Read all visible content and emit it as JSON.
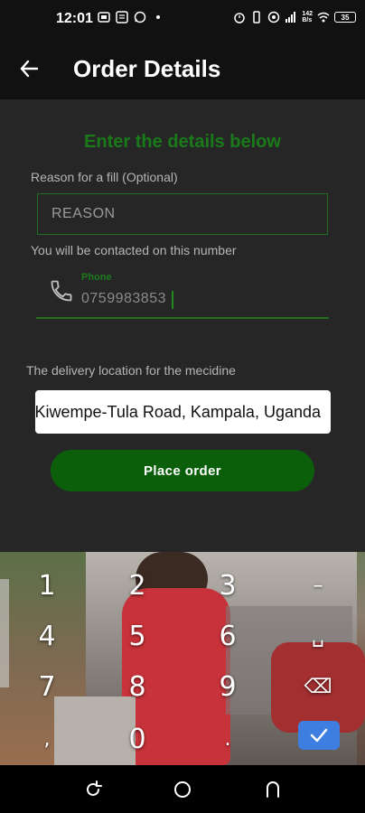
{
  "status_bar": {
    "time": "12:01",
    "network_speed_top": "142",
    "network_speed_bottom": "B/s",
    "battery": "35"
  },
  "header": {
    "title": "Order Details",
    "back_icon": "arrow-left-icon"
  },
  "form": {
    "heading": "Enter the details below",
    "reason_label": "Reason for a fill (Optional)",
    "reason_placeholder": "REASON",
    "contact_label": "You will be contacted on  this number",
    "phone_floating_label": "Phone",
    "phone_value": "0759983853",
    "delivery_label": "The delivery location for the mecidine",
    "delivery_value": "Kampala-Nakawa, Kitintale, Luzira, Mutungo, Kisugu, Kansanga, Muyenga, Bukasa, Gaba-Kiwempe-Tula Road, Kampala, Uganda",
    "submit_label": "Place order"
  },
  "keyboard": {
    "keys": [
      {
        "label": "1"
      },
      {
        "label": "2"
      },
      {
        "label": "3"
      },
      {
        "label": "–"
      },
      {
        "label": "4"
      },
      {
        "label": "5"
      },
      {
        "label": "6"
      },
      {
        "label": "␣"
      },
      {
        "label": "7"
      },
      {
        "label": "8"
      },
      {
        "label": "9"
      },
      {
        "label": "⌫"
      },
      {
        "label": ","
      },
      {
        "label": "0"
      },
      {
        "label": "."
      },
      {
        "label": "✓"
      }
    ],
    "accent_color": "#3d7ee0"
  },
  "colors": {
    "background": "#262626",
    "accent_green": "#1a7a1a",
    "button_green": "#0b5f0b"
  }
}
